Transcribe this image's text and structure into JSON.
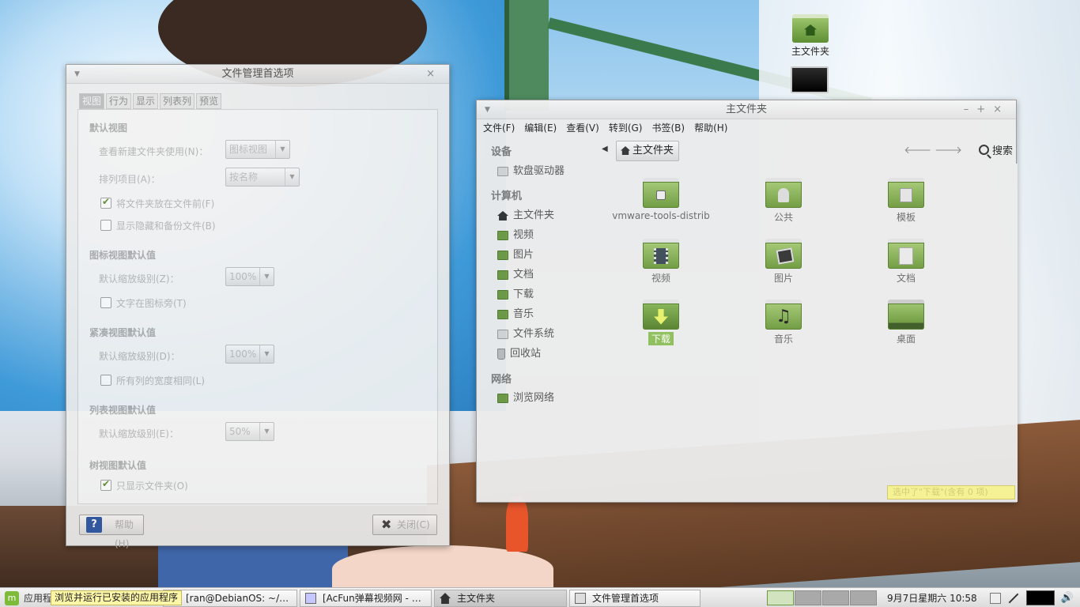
{
  "desktop": {
    "icons": [
      {
        "label": "主文件夹",
        "icon": "home-folder-icon"
      },
      {
        "label": "",
        "icon": "computer-icon"
      }
    ]
  },
  "prefs_dialog": {
    "title": "文件管理首选项",
    "tabs": [
      "视图",
      "行为",
      "显示",
      "列表列",
      "预览"
    ],
    "active_tab": "视图",
    "sections": {
      "default_view": {
        "title": "默认视图",
        "new_folder_label": "查看新建文件夹使用(N)：",
        "new_folder_value": "图标视图",
        "sort_label": "排列项目(A)：",
        "sort_value": "按名称",
        "folders_first_label": "将文件夹放在文件前(F)",
        "folders_first_checked": true,
        "show_hidden_label": "显示隐藏和备份文件(B)",
        "show_hidden_checked": false
      },
      "icon_view": {
        "title": "图标视图默认值",
        "zoom_label": "默认缩放级别(Z)：",
        "zoom_value": "100%",
        "text_beside_label": "文字在图标旁(T)",
        "text_beside_checked": false
      },
      "compact_view": {
        "title": "紧凑视图默认值",
        "zoom_label": "默认缩放级别(D)：",
        "zoom_value": "100%",
        "same_width_label": "所有列的宽度相同(L)",
        "same_width_checked": false
      },
      "list_view": {
        "title": "列表视图默认值",
        "zoom_label": "默认缩放级别(E)：",
        "zoom_value": "50%"
      },
      "tree_view": {
        "title": "树视图默认值",
        "only_folders_label": "只显示文件夹(O)",
        "only_folders_checked": true
      }
    },
    "help_button": "帮助(H)",
    "close_button": "关闭(C)"
  },
  "file_manager": {
    "title": "主文件夹",
    "menu": [
      "文件(F)",
      "编辑(E)",
      "查看(V)",
      "转到(G)",
      "书签(B)",
      "帮助(H)"
    ],
    "sidebar": {
      "devices_title": "设备",
      "devices": [
        {
          "label": "软盘驱动器",
          "icon": "floppy-icon"
        }
      ],
      "computer_title": "计算机",
      "computer": [
        {
          "label": "主文件夹",
          "icon": "home-icon"
        },
        {
          "label": "视频",
          "icon": "video-folder-icon"
        },
        {
          "label": "图片",
          "icon": "pictures-folder-icon"
        },
        {
          "label": "文档",
          "icon": "documents-folder-icon"
        },
        {
          "label": "下载",
          "icon": "downloads-folder-icon"
        },
        {
          "label": "音乐",
          "icon": "music-folder-icon"
        },
        {
          "label": "文件系统",
          "icon": "filesystem-icon"
        },
        {
          "label": "回收站",
          "icon": "trash-icon"
        }
      ],
      "network_title": "网络",
      "network": [
        {
          "label": "浏览网络",
          "icon": "network-icon"
        }
      ]
    },
    "path": "主文件夹",
    "search_label": "搜索",
    "files": [
      {
        "name": "vmware-tools-distrib",
        "icon": "lock-folder-icon"
      },
      {
        "name": "公共",
        "icon": "public-folder-icon"
      },
      {
        "name": "模板",
        "icon": "templates-folder-icon"
      },
      {
        "name": "视频",
        "icon": "video-folder-icon"
      },
      {
        "name": "图片",
        "icon": "pictures-folder-icon"
      },
      {
        "name": "文档",
        "icon": "documents-folder-icon"
      },
      {
        "name": "下载",
        "icon": "downloads-folder-icon",
        "selected": true
      },
      {
        "name": "音乐",
        "icon": "music-folder-icon"
      },
      {
        "name": "桌面",
        "icon": "desktop-folder-icon"
      }
    ],
    "status": "选中了\"下载\"(含有 0 项)"
  },
  "taskbar": {
    "menu_label": "应用程序",
    "tooltip": "浏览并运行已安装的应用程序",
    "tasks": [
      {
        "label": "[ran@DebianOS: ~/…"
      },
      {
        "label": "[AcFun弹幕视频网 - …"
      },
      {
        "label": "主文件夹",
        "active": true
      },
      {
        "label": "文件管理首选项"
      }
    ],
    "clock": "9月7日星期六 10:58"
  }
}
